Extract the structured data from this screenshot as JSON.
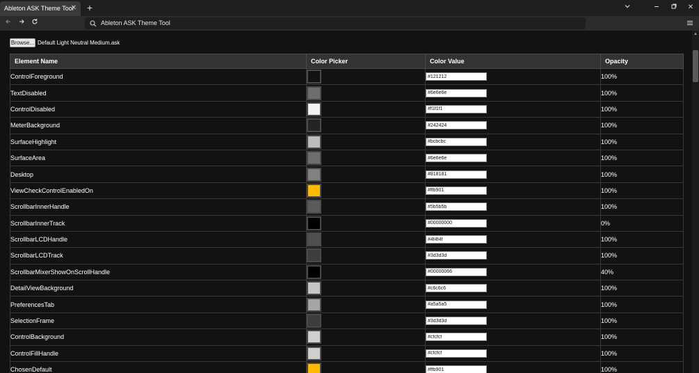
{
  "browser": {
    "tab_title": "Ableton ASK Theme Tool",
    "address": "Ableton ASK Theme Tool"
  },
  "page": {
    "browse_label": "Browse...",
    "file_name": "Default Light Neutral Medium.ask",
    "columns": [
      "Element Name",
      "Color Picker",
      "Color Value",
      "Opacity"
    ]
  },
  "rows": [
    {
      "name": "ControlForeground",
      "swatch": "#121212",
      "value": "#121212",
      "opacity": "100%"
    },
    {
      "name": "TextDisabled",
      "swatch": "#6e6e6e",
      "value": "#6e6e6e",
      "opacity": "100%"
    },
    {
      "name": "ControlDisabled",
      "swatch": "#f1f1f1",
      "value": "#f1f1f1",
      "opacity": "100%"
    },
    {
      "name": "MeterBackground",
      "swatch": "#242424",
      "value": "#242424",
      "opacity": "100%"
    },
    {
      "name": "SurfaceHighlight",
      "swatch": "#bcbcbc",
      "value": "#bcbcbc",
      "opacity": "100%"
    },
    {
      "name": "SurfaceArea",
      "swatch": "#6e6e6e",
      "value": "#6e6e6e",
      "opacity": "100%"
    },
    {
      "name": "Desktop",
      "swatch": "#818181",
      "value": "#818181",
      "opacity": "100%"
    },
    {
      "name": "ViewCheckControlEnabledOn",
      "swatch": "#ffb901",
      "value": "#ffb901",
      "opacity": "100%"
    },
    {
      "name": "ScrollbarInnerHandle",
      "swatch": "#5b5b5b",
      "value": "#5b5b5b",
      "opacity": "100%"
    },
    {
      "name": "ScrollbarInnerTrack",
      "swatch": "#000000",
      "value": "#00000000",
      "opacity": "0%"
    },
    {
      "name": "ScrollbarLCDHandle",
      "swatch": "#4f4f4f",
      "value": "#4f4f4f",
      "opacity": "100%"
    },
    {
      "name": "ScrollbarLCDTrack",
      "swatch": "#3d3d3d",
      "value": "#3d3d3d",
      "opacity": "100%"
    },
    {
      "name": "ScrollbarMixerShowOnScrollHandle",
      "swatch": "#000000",
      "value": "#00000066",
      "opacity": "40%"
    },
    {
      "name": "DetailViewBackground",
      "swatch": "#c6c6c6",
      "value": "#c6c6c6",
      "opacity": "100%"
    },
    {
      "name": "PreferencesTab",
      "swatch": "#a5a5a5",
      "value": "#a5a5a5",
      "opacity": "100%"
    },
    {
      "name": "SelectionFrame",
      "swatch": "#3d3d3d",
      "value": "#3d3d3d",
      "opacity": "100%"
    },
    {
      "name": "ControlBackground",
      "swatch": "#cfcfcf",
      "value": "#cfcfcf",
      "opacity": "100%"
    },
    {
      "name": "ControlFillHandle",
      "swatch": "#cfcfcf",
      "value": "#cfcfcf",
      "opacity": "100%"
    },
    {
      "name": "ChosenDefault",
      "swatch": "#ffb901",
      "value": "#ffb901",
      "opacity": "100%"
    }
  ]
}
